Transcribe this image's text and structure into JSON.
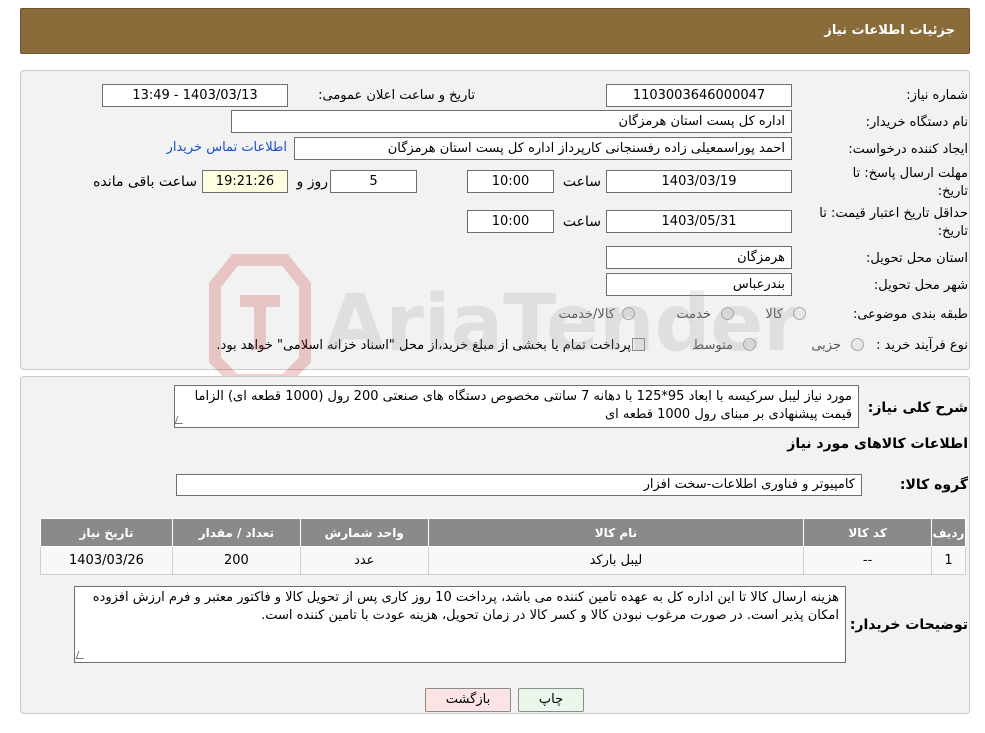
{
  "header": {
    "title": "جزئیات اطلاعات نیاز"
  },
  "details": {
    "need_number_label": "شماره نیاز:",
    "need_number": "1103003646000047",
    "announce_label": "تاریخ و ساعت اعلان عمومی:",
    "announce_value": "1403/03/13 - 13:49",
    "buyer_org_label": "نام دستگاه خریدار:",
    "buyer_org": "اداره کل پست استان هرمزگان",
    "creator_label": "ایجاد کننده درخواست:",
    "creator": "احمد پوراسمعیلی زاده رفسنجانی کارپرداز اداره کل پست استان هرمزگان",
    "contact_link": "اطلاعات تماس خریدار",
    "reply_deadline_label_1": "مهلت ارسال پاسخ: تا",
    "reply_deadline_label_2": "تاریخ:",
    "reply_date": "1403/03/19",
    "time_label": "ساعت",
    "reply_time": "10:00",
    "days_value": "5",
    "days_label": "روز و",
    "remaining_time": "19:21:26",
    "remaining_label": "ساعت باقی مانده",
    "price_validity_label_1": "حداقل تاریخ اعتبار قیمت: تا",
    "price_validity_label_2": "تاریخ:",
    "price_validity_date": "1403/05/31",
    "price_validity_time": "10:00",
    "province_label": "استان محل تحویل:",
    "province": "هرمزگان",
    "city_label": "شهر محل تحویل:",
    "city": "بندرعباس",
    "category_label": "طبقه بندی موضوعی:",
    "category_options": [
      "کالا",
      "خدمت",
      "کالا/خدمت"
    ],
    "process_label": "نوع فرآیند خرید :",
    "process_options": [
      "جزیی",
      "متوسط"
    ],
    "process_note": "پرداخت تمام یا بخشی از مبلغ خرید،از محل \"اسناد خزانه اسلامی\" خواهد بود."
  },
  "description": {
    "label": "شرح کلی نیاز:",
    "text": "مورد نیاز لیبل سرکیسه با ابعاد 95*125 با دهانه 7 سانتی مخصوص دستگاه های صنعتی 200 رول (1000 قطعه ای) الزاما قیمت پیشنهادی بر مبنای رول 1000 قطعه ای"
  },
  "goods": {
    "section_title": "اطلاعات کالاهای مورد نیاز",
    "group_label": "گروه کالا:",
    "group_value": "کامپیوتر و فناوری اطلاعات-سخت افزار",
    "columns": [
      "ردیف",
      "کد کالا",
      "نام کالا",
      "واحد شمارش",
      "تعداد / مقدار",
      "تاریخ نیاز"
    ],
    "rows": [
      {
        "row": "1",
        "code": "--",
        "name": "لیبل بارکد",
        "unit": "عدد",
        "qty": "200",
        "date": "1403/03/26"
      }
    ]
  },
  "buyer_notes": {
    "label": "توضیحات خریدار:",
    "text": "هزینه ارسال کالا تا این اداره کل به عهده تامین کننده می باشد، پرداخت 10 روز کاری پس از تحویل کالا و فاکتور معتبر و فرم ارزش افزوده امکان پذیر است. در صورت مرغوب نبودن کالا و کسر کالا در زمان تحویل، هزینه عودت با تامین کننده است."
  },
  "buttons": {
    "print": "چاپ",
    "back": "بازگشت"
  },
  "watermark": {
    "text": "AriaTender.neT"
  },
  "colors": {
    "header": "#8a6c3b",
    "link": "#1b4fc8",
    "table_header": "#8a8a8a",
    "print_btn": "#e9f6e9",
    "back_btn": "#fbe4e4"
  }
}
